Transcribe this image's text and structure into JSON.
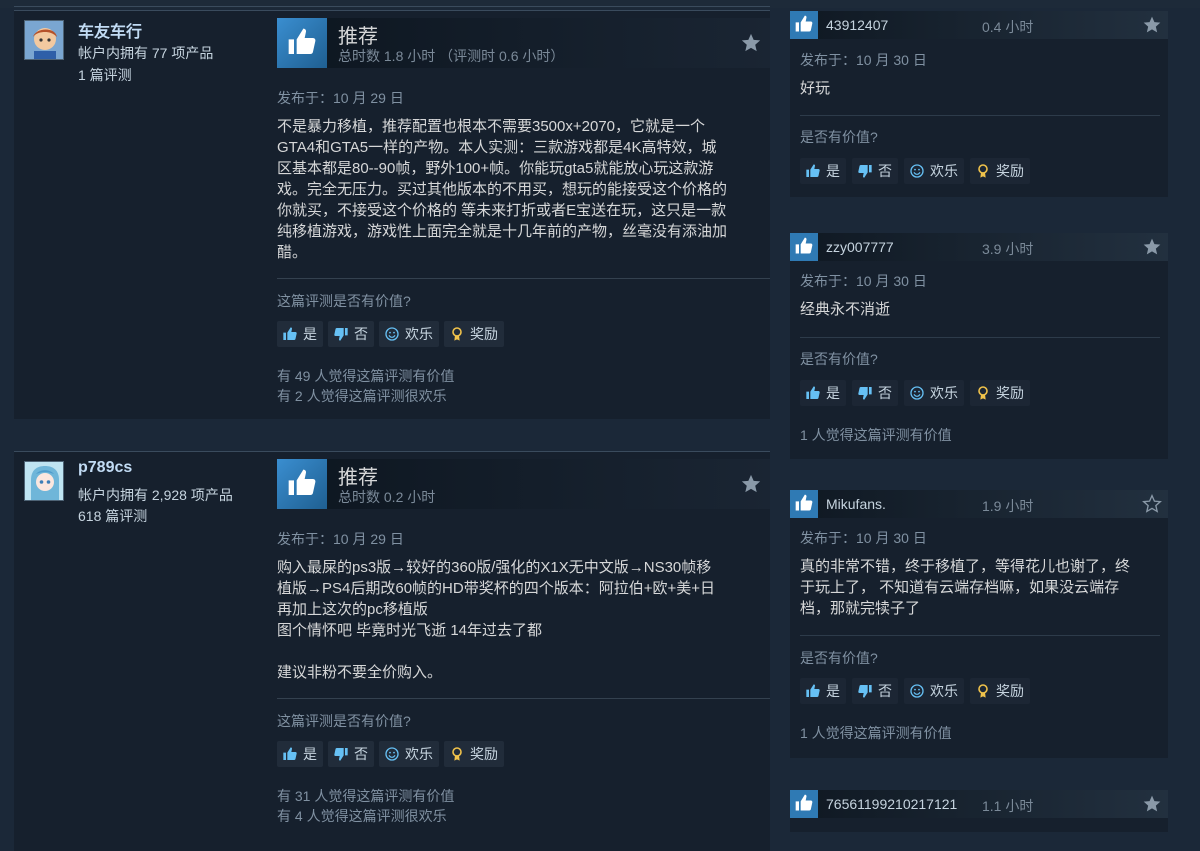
{
  "colors": {
    "accent": "#66c0f4",
    "background": "#1b2838",
    "card": "#16202d",
    "thumb_blue": "#2f7ab4"
  },
  "reviews": [
    {
      "author": "车友车行",
      "products": "帐户内拥有 77 项产品",
      "review_count": "1 篇评测",
      "verdict": "推荐",
      "hours": "总时数 1.8 小时 （评测时 0.6 小时）",
      "posted": "发布于：10 月 29 日",
      "content": "不是暴力移植，推荐配置也根本不需要3500x+2070，它就是一个\nGTA4和GTA5一样的产物。本人实测：三款游戏都是4K高特效，城\n区基本都是80--90帧，野外100+帧。你能玩gta5就能放心玩这款游\n戏。完全无压力。买过其他版本的不用买，想玩的能接受这个价格的\n你就买，不接受这个价格的 等未来打折或者E宝送在玩，这只是一款\n纯移植游戏，游戏性上面完全就是十几年前的产物，丝毫没有添油加\n醋。",
      "helpful_question": "这篇评测是否有价值?",
      "buttons": {
        "yes": "是",
        "no": "否",
        "funny": "欢乐",
        "award": "奖励"
      },
      "stat_helpful": "有 49 人觉得这篇评测有价值",
      "stat_funny": "有 2 人觉得这篇评测很欢乐",
      "icons": {
        "avatar": "avatar-icon",
        "thumb": "thumbs-up-icon",
        "star": "star-icon"
      }
    },
    {
      "author": "p789cs",
      "products": "帐户内拥有 2,928 项产品",
      "review_count": "618 篇评测",
      "verdict": "推荐",
      "hours": "总时数 0.2 小时",
      "posted": "发布于：10 月 29 日",
      "content": "购入最屎的ps3版→较好的360版/强化的X1X无中文版→NS30帧移\n植版→PS4后期改60帧的HD带奖杯的四个版本：阿拉伯+欧+美+日\n再加上这次的pc移植版\n图个情怀吧 毕竟时光飞逝 14年过去了都\n\n建议非粉不要全价购入。",
      "helpful_question": "这篇评测是否有价值?",
      "buttons": {
        "yes": "是",
        "no": "否",
        "funny": "欢乐",
        "award": "奖励"
      },
      "stat_helpful": "有 31 人觉得这篇评测有价值",
      "stat_funny": "有 4 人觉得这篇评测很欢乐",
      "icons": {
        "avatar": "avatar-icon",
        "thumb": "thumbs-up-icon",
        "star": "star-icon"
      }
    }
  ],
  "mini_reviews": [
    {
      "name": "43912407",
      "hours": "0.4 小时",
      "posted": "发布于：10 月 30 日",
      "text": "好玩",
      "question": "是否有价值?",
      "buttons": {
        "yes": "是",
        "no": "否",
        "funny": "欢乐",
        "award": "奖励"
      },
      "stat": ""
    },
    {
      "name": "zzy007777",
      "hours": "3.9 小时",
      "posted": "发布于：10 月 30 日",
      "text": "经典永不消逝",
      "question": "是否有价值?",
      "buttons": {
        "yes": "是",
        "no": "否",
        "funny": "欢乐",
        "award": "奖励"
      },
      "stat": "1 人觉得这篇评测有价值"
    },
    {
      "name": "Mikufans.",
      "hours": "1.9 小时",
      "posted": "发布于：10 月 30 日",
      "text": "真的非常不错，终于移植了，等得花儿也谢了，终\n于玩上了， 不知道有云端存档嘛，如果没云端存\n档，那就完犊子了",
      "question": "是否有价值?",
      "buttons": {
        "yes": "是",
        "no": "否",
        "funny": "欢乐",
        "award": "奖励"
      },
      "stat": "1 人觉得这篇评测有价值"
    },
    {
      "name": "76561199210217121",
      "hours": "1.1 小时"
    }
  ]
}
